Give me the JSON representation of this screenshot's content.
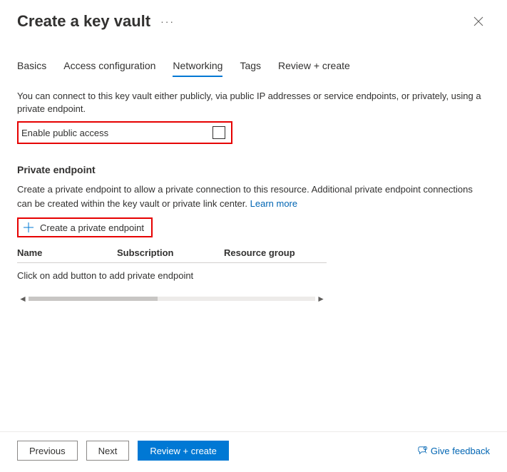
{
  "header": {
    "title": "Create a key vault"
  },
  "tabs": [
    "Basics",
    "Access configuration",
    "Networking",
    "Tags",
    "Review + create"
  ],
  "active_tab": "Networking",
  "networking": {
    "intro": "You can connect to this key vault either publicly, via public IP addresses or service endpoints, or privately, using a private endpoint.",
    "enable_public_label": "Enable public access",
    "enable_public_checked": false,
    "pe_heading": "Private endpoint",
    "pe_description": "Create a private endpoint to allow a private connection to this resource. Additional private endpoint connections can be created within the key vault or private link center. ",
    "learn_more": "Learn more",
    "create_pe_label": "Create a private endpoint",
    "table": {
      "headers": [
        "Name",
        "Subscription",
        "Resource group"
      ],
      "rows": [],
      "empty_message": "Click on add button to add private endpoint"
    }
  },
  "footer": {
    "previous": "Previous",
    "next": "Next",
    "review_create": "Review + create",
    "feedback": "Give feedback"
  },
  "highlights": [
    "enable-public-access-row",
    "create-private-endpoint-button"
  ],
  "colors": {
    "accent": "#0078d4",
    "link": "#0065b3",
    "highlight_border": "#e60000"
  }
}
